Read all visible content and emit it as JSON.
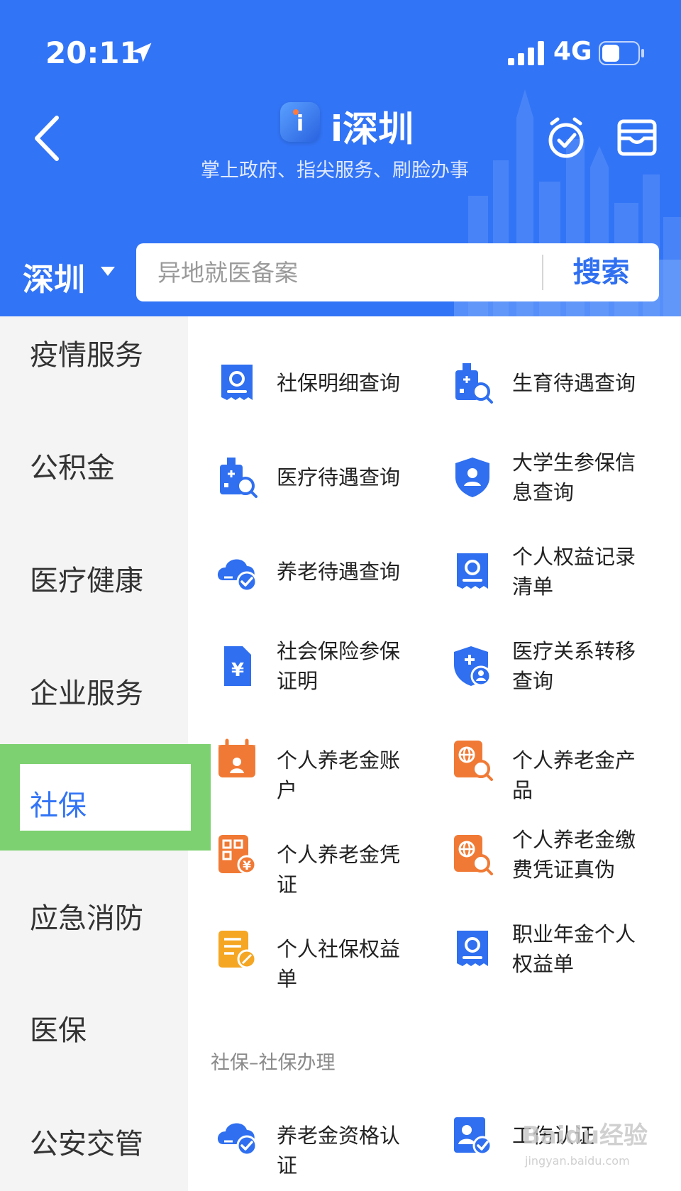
{
  "status": {
    "time": "20:11",
    "network": "4G"
  },
  "header": {
    "app_name": "i深圳",
    "slogan": "掌上政府、指尖服务、刷脸办事"
  },
  "search": {
    "city": "深圳",
    "placeholder": "异地就医备案",
    "button": "搜索"
  },
  "sidebar": {
    "items": [
      "疫情服务",
      "公积金",
      "医疗健康",
      "企业服务",
      "社保",
      "应急消防",
      "医保",
      "公安交管"
    ],
    "active": "社保"
  },
  "services": [
    {
      "label": "社保明细查询",
      "icon": "receipt-search-icon",
      "color": "#2f6ff0"
    },
    {
      "label": "生育待遇查询",
      "icon": "hospital-search-icon",
      "color": "#2f6ff0"
    },
    {
      "label": "医疗待遇查询",
      "icon": "hospital-search-icon",
      "color": "#2f6ff0"
    },
    {
      "label": "大学生参保信息查询",
      "icon": "shield-user-icon",
      "color": "#2f6ff0"
    },
    {
      "label": "养老待遇查询",
      "icon": "cloud-check-icon",
      "color": "#2f6ff0"
    },
    {
      "label": "个人权益记录清单",
      "icon": "receipt-search-icon",
      "color": "#2f6ff0"
    },
    {
      "label": "社会保险参保证明",
      "icon": "document-yuan-icon",
      "color": "#2f6ff0"
    },
    {
      "label": "医疗关系转移查询",
      "icon": "shield-plus-user-icon",
      "color": "#2f6ff0"
    },
    {
      "label": "个人养老金账户",
      "icon": "calendar-user-icon",
      "color": "#f07a35"
    },
    {
      "label": "个人养老金产品",
      "icon": "globe-search-icon",
      "color": "#f07a35"
    },
    {
      "label": "个人养老金凭证",
      "icon": "qrcode-yuan-icon",
      "color": "#f07a35"
    },
    {
      "label": "个人养老金缴费凭证真伪",
      "icon": "globe-search-icon",
      "color": "#f07a35"
    },
    {
      "label": "个人社保权益单",
      "icon": "document-edit-icon",
      "color": "#f5a623"
    },
    {
      "label": "职业年金个人权益单",
      "icon": "receipt-search-icon",
      "color": "#2f6ff0"
    }
  ],
  "section2": {
    "title": "社保–社保办理",
    "services": [
      {
        "label": "养老金资格认证",
        "icon": "cloud-check-icon",
        "color": "#2f6ff0"
      },
      {
        "label": "工伤认证",
        "icon": "id-card-check-icon",
        "color": "#2f6ff0"
      }
    ]
  },
  "watermark": {
    "text": "Baidu经验",
    "url_text": "jingyan.baidu.com"
  }
}
